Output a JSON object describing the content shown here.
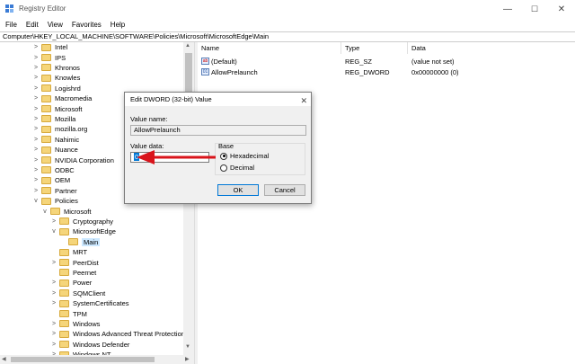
{
  "window": {
    "title": "Registry Editor",
    "minimize": "—",
    "maximize": "☐",
    "close": "✕"
  },
  "menu": [
    "File",
    "Edit",
    "View",
    "Favorites",
    "Help"
  ],
  "address": "Computer\\HKEY_LOCAL_MACHINE\\SOFTWARE\\Policies\\Microsoft\\MicrosoftEdge\\Main",
  "tree": [
    {
      "label": "Intel",
      "level": 0,
      "chev": ">"
    },
    {
      "label": "IPS",
      "level": 0,
      "chev": ">"
    },
    {
      "label": "Khronos",
      "level": 0,
      "chev": ">"
    },
    {
      "label": "Knowles",
      "level": 0,
      "chev": ">"
    },
    {
      "label": "Logishrd",
      "level": 0,
      "chev": ">"
    },
    {
      "label": "Macromedia",
      "level": 0,
      "chev": ">"
    },
    {
      "label": "Microsoft",
      "level": 0,
      "chev": ">"
    },
    {
      "label": "Mozilla",
      "level": 0,
      "chev": ">"
    },
    {
      "label": "mozilla.org",
      "level": 0,
      "chev": ">"
    },
    {
      "label": "Nahimic",
      "level": 0,
      "chev": ">"
    },
    {
      "label": "Nuance",
      "level": 0,
      "chev": ">"
    },
    {
      "label": "NVIDIA Corporation",
      "level": 0,
      "chev": ">"
    },
    {
      "label": "ODBC",
      "level": 0,
      "chev": ">"
    },
    {
      "label": "OEM",
      "level": 0,
      "chev": ">"
    },
    {
      "label": "Partner",
      "level": 0,
      "chev": ">"
    },
    {
      "label": "Policies",
      "level": 0,
      "chev": "v"
    },
    {
      "label": "Microsoft",
      "level": 1,
      "chev": "v"
    },
    {
      "label": "Cryptography",
      "level": 2,
      "chev": ">"
    },
    {
      "label": "MicrosoftEdge",
      "level": 2,
      "chev": "v"
    },
    {
      "label": "Main",
      "level": 3,
      "chev": "",
      "selected": true
    },
    {
      "label": "MRT",
      "level": 2,
      "chev": ""
    },
    {
      "label": "PeerDist",
      "level": 2,
      "chev": ">"
    },
    {
      "label": "Peernet",
      "level": 2,
      "chev": ""
    },
    {
      "label": "Power",
      "level": 2,
      "chev": ">"
    },
    {
      "label": "SQMClient",
      "level": 2,
      "chev": ">"
    },
    {
      "label": "SystemCertificates",
      "level": 2,
      "chev": ">"
    },
    {
      "label": "TPM",
      "level": 2,
      "chev": ""
    },
    {
      "label": "Windows",
      "level": 2,
      "chev": ">"
    },
    {
      "label": "Windows Advanced Threat Protection",
      "level": 2,
      "chev": ">"
    },
    {
      "label": "Windows Defender",
      "level": 2,
      "chev": ">"
    },
    {
      "label": "Windows NT",
      "level": 2,
      "chev": ">"
    }
  ],
  "list": {
    "headers": [
      "Name",
      "Type",
      "Data"
    ],
    "rows": [
      {
        "icon": "ab",
        "name": "(Default)",
        "type": "REG_SZ",
        "data": "(value not set)"
      },
      {
        "icon": "01",
        "name": "AllowPrelaunch",
        "type": "REG_DWORD",
        "data": "0x00000000 (0)"
      }
    ]
  },
  "dialog": {
    "title": "Edit DWORD (32-bit) Value",
    "value_name_label": "Value name:",
    "value_name": "AllowPrelaunch",
    "value_data_label": "Value data:",
    "value_data": "0",
    "base_label": "Base",
    "hex_label": "Hexadecimal",
    "dec_label": "Decimal",
    "selected_base": "Hexadecimal",
    "ok": "OK",
    "cancel": "Cancel"
  },
  "colors": {
    "arrow": "#d9141b",
    "selection": "#cce8ff",
    "folder": "#f5d57a"
  }
}
